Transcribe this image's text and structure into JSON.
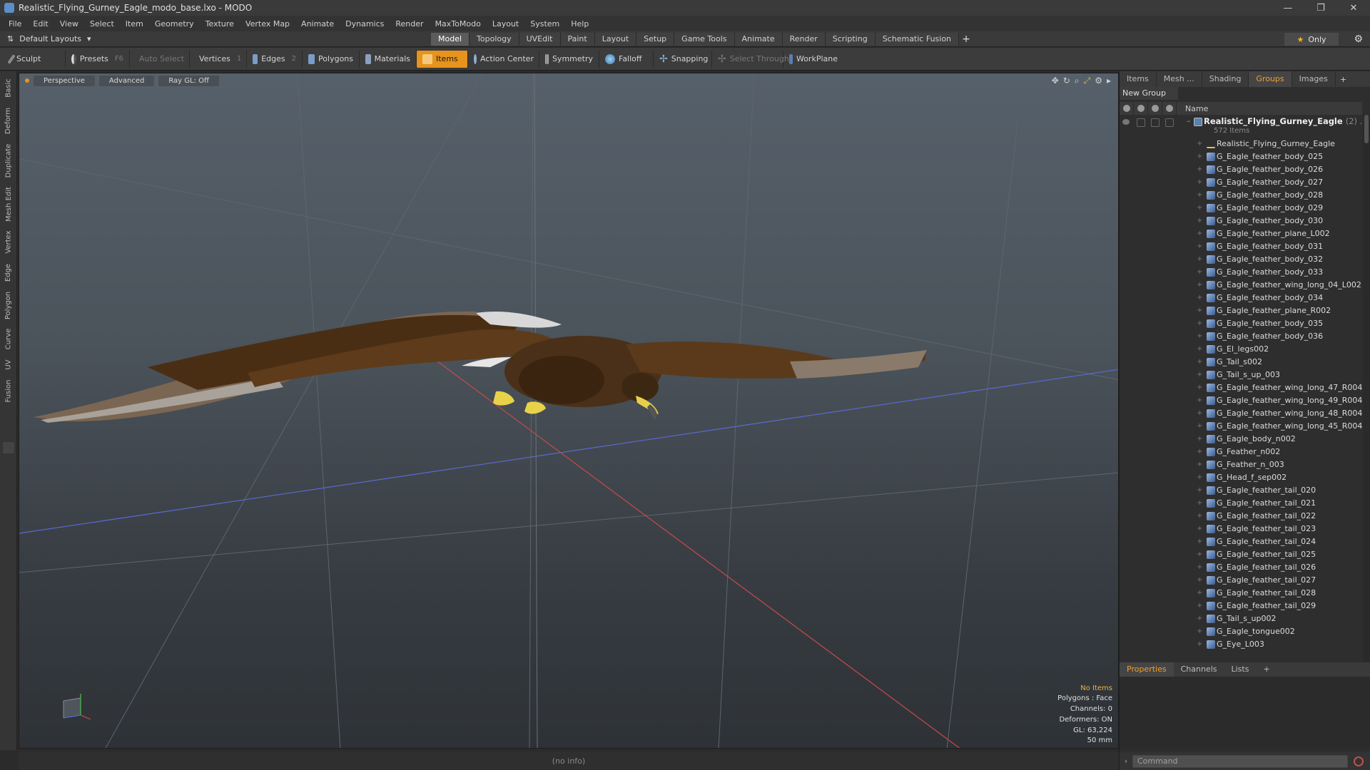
{
  "window": {
    "title": "Realistic_Flying_Gurney_Eagle_modo_base.lxo - MODO",
    "controls": [
      "—",
      "❐",
      "✕"
    ]
  },
  "menu": [
    "File",
    "Edit",
    "View",
    "Select",
    "Item",
    "Geometry",
    "Texture",
    "Vertex Map",
    "Animate",
    "Dynamics",
    "Render",
    "MaxToModo",
    "Layout",
    "System",
    "Help"
  ],
  "layout_bar": {
    "layout_dropdown": "Default Layouts",
    "tabs": [
      "Model",
      "Topology",
      "UVEdit",
      "Paint",
      "Layout",
      "Setup",
      "Game Tools",
      "Animate",
      "Render",
      "Scripting",
      "Schematic Fusion"
    ],
    "active_tab": "Model",
    "only_label": "Only"
  },
  "toolbar": {
    "sculpt": "Sculpt",
    "presets": "Presets",
    "presets_key": "F6",
    "auto_select": "Auto Select",
    "vertices": "Vertices",
    "vertices_key": "1",
    "edges": "Edges",
    "edges_key": "2",
    "polygons": "Polygons",
    "materials": "Materials",
    "items": "Items",
    "action_center": "Action Center",
    "symmetry": "Symmetry",
    "falloff": "Falloff",
    "snapping": "Snapping",
    "select_through": "Select Through",
    "workplane": "WorkPlane"
  },
  "left_strip": [
    "Basic",
    "Deform",
    "Duplicate",
    "Mesh Edit",
    "Vertex",
    "Edge",
    "Polygon",
    "Curve",
    "UV",
    "Fusion"
  ],
  "viewport": {
    "view_mode": "Perspective",
    "shading": "Advanced",
    "raygl": "Ray GL: Off",
    "info": {
      "no_items": "No Items",
      "polygons": "Polygons : Face",
      "channels": "Channels: 0",
      "deformers": "Deformers: ON",
      "gl": "GL: 63,224",
      "lens": "50 mm"
    }
  },
  "status_bar": {
    "text": "(no info)"
  },
  "right_panel": {
    "tabs": [
      "Items",
      "Mesh ...",
      "Shading",
      "Groups",
      "Images"
    ],
    "active_tab": "Groups",
    "new_group": "New Group",
    "name_header": "Name",
    "root": {
      "name": "Realistic_Flying_Gurney_Eagle",
      "count": "(2) ...",
      "subtitle": "572 Items"
    },
    "items": [
      "Realistic_Flying_Gurney_Eagle",
      "G_Eagle_feather_body_025",
      "G_Eagle_feather_body_026",
      "G_Eagle_feather_body_027",
      "G_Eagle_feather_body_028",
      "G_Eagle_feather_body_029",
      "G_Eagle_feather_body_030",
      "G_Eagle_feather_plane_L002",
      "G_Eagle_feather_body_031",
      "G_Eagle_feather_body_032",
      "G_Eagle_feather_body_033",
      "G_Eagle_feather_wing_long_04_L002",
      "G_Eagle_feather_body_034",
      "G_Eagle_feather_plane_R002",
      "G_Eagle_feather_body_035",
      "G_Eagle_feather_body_036",
      "G_El_legs002",
      "G_Tail_s002",
      "G_Tail_s_up_003",
      "G_Eagle_feather_wing_long_47_R004",
      "G_Eagle_feather_wing_long_49_R004",
      "G_Eagle_feather_wing_long_48_R004",
      "G_Eagle_feather_wing_long_45_R004",
      "G_Eagle_body_n002",
      "G_Feather_n002",
      "G_Feather_n_003",
      "G_Head_f_sep002",
      "G_Eagle_feather_tail_020",
      "G_Eagle_feather_tail_021",
      "G_Eagle_feather_tail_022",
      "G_Eagle_feather_tail_023",
      "G_Eagle_feather_tail_024",
      "G_Eagle_feather_tail_025",
      "G_Eagle_feather_tail_026",
      "G_Eagle_feather_tail_027",
      "G_Eagle_feather_tail_028",
      "G_Eagle_feather_tail_029",
      "G_Tail_s_up002",
      "G_Eagle_tongue002",
      "G_Eye_L003"
    ],
    "props_tabs": [
      "Properties",
      "Channels",
      "Lists"
    ],
    "props_active": "Properties",
    "command_placeholder": "Command"
  },
  "colors": {
    "accent": "#e8931c",
    "panel_active_text": "#f0a030",
    "axis_x": "#c84a4a",
    "axis_z": "#5a6ad0"
  }
}
